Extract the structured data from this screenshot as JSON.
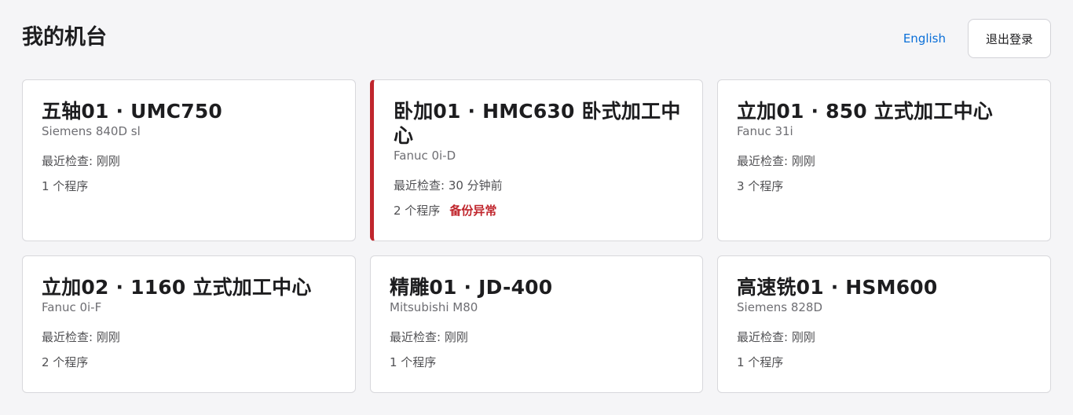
{
  "header": {
    "title": "我的机台",
    "language_link": "English",
    "logout_label": "退出登录"
  },
  "colors": {
    "accent_link": "#0a6fd8",
    "alert": "#c0262d"
  },
  "machines": [
    {
      "title": "五轴01 · UMC750",
      "controller": "Siemens 840D sl",
      "last_check": "最近检查: 刚刚",
      "programs": "1 个程序",
      "warning": ""
    },
    {
      "title": "卧加01 · HMC630 卧式加工中心",
      "controller": "Fanuc 0i-D",
      "last_check": "最近检查: 30 分钟前",
      "programs": "2 个程序",
      "warning": "备份异常"
    },
    {
      "title": "立加01 · 850 立式加工中心",
      "controller": "Fanuc 31i",
      "last_check": "最近检查: 刚刚",
      "programs": "3 个程序",
      "warning": ""
    },
    {
      "title": "立加02 · 1160 立式加工中心",
      "controller": "Fanuc 0i-F",
      "last_check": "最近检查: 刚刚",
      "programs": "2 个程序",
      "warning": ""
    },
    {
      "title": "精雕01 · JD-400",
      "controller": "Mitsubishi M80",
      "last_check": "最近检查: 刚刚",
      "programs": "1 个程序",
      "warning": ""
    },
    {
      "title": "高速铣01 · HSM600",
      "controller": "Siemens 828D",
      "last_check": "最近检查: 刚刚",
      "programs": "1 个程序",
      "warning": ""
    }
  ]
}
